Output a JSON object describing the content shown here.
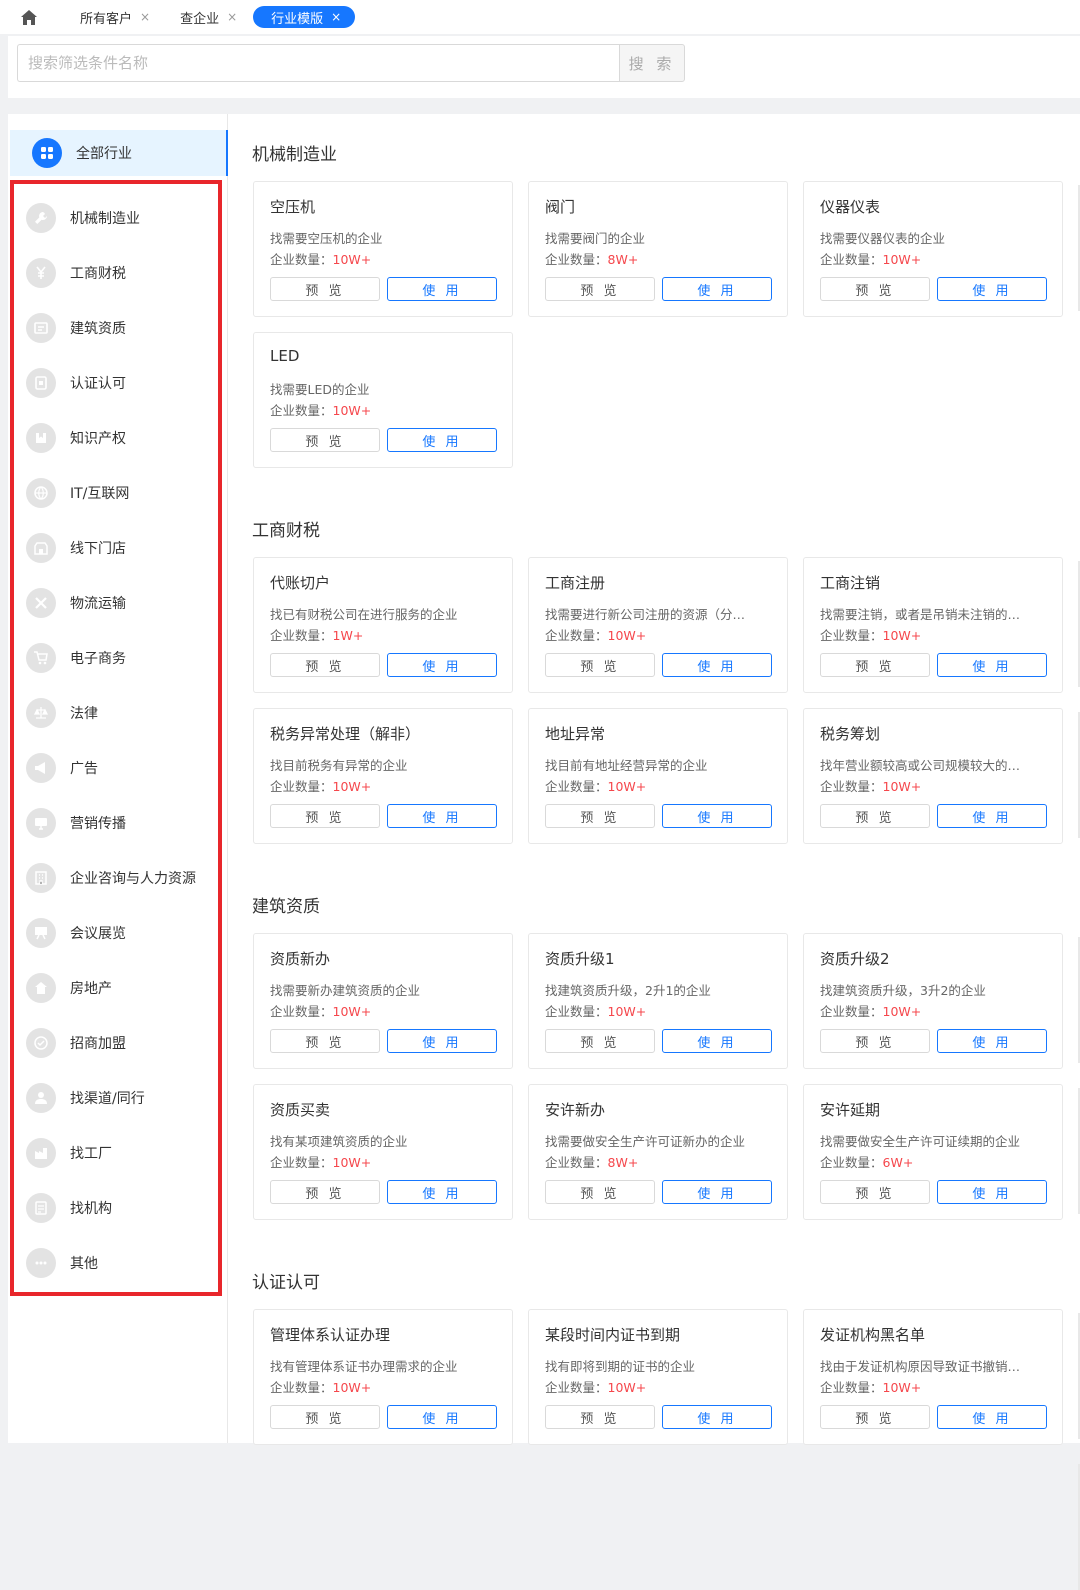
{
  "tabs": [
    {
      "label": "所有客户",
      "close": "×",
      "active": false
    },
    {
      "label": "查企业",
      "close": "×",
      "active": false
    },
    {
      "label": "行业模版",
      "close": "×",
      "active": true
    }
  ],
  "search": {
    "placeholder": "搜索筛选条件名称",
    "button_label": "搜 索"
  },
  "sidebar": {
    "all": {
      "label": "全部行业",
      "icon": "grid-icon"
    },
    "items": [
      {
        "label": "机械制造业",
        "icon": "wrench-icon"
      },
      {
        "label": "工商财税",
        "icon": "yen-icon"
      },
      {
        "label": "建筑资质",
        "icon": "certificate-icon"
      },
      {
        "label": "认证认可",
        "icon": "badge-icon"
      },
      {
        "label": "知识产权",
        "icon": "bookmark-icon"
      },
      {
        "label": "IT/互联网",
        "icon": "globe-icon"
      },
      {
        "label": "线下门店",
        "icon": "store-icon"
      },
      {
        "label": "物流运输",
        "icon": "cross-icon"
      },
      {
        "label": "电子商务",
        "icon": "cart-icon"
      },
      {
        "label": "法律",
        "icon": "scale-icon"
      },
      {
        "label": "广告",
        "icon": "megaphone-icon"
      },
      {
        "label": "营销传播",
        "icon": "monitor-icon"
      },
      {
        "label": "企业咨询与人力资源",
        "icon": "building-icon"
      },
      {
        "label": "会议展览",
        "icon": "display-icon"
      },
      {
        "label": "房地产",
        "icon": "house-icon"
      },
      {
        "label": "招商加盟",
        "icon": "handshake-icon"
      },
      {
        "label": "找渠道/同行",
        "icon": "user-icon"
      },
      {
        "label": "找工厂",
        "icon": "factory-icon"
      },
      {
        "label": "找机构",
        "icon": "institution-icon"
      },
      {
        "label": "其他",
        "icon": "more-icon"
      }
    ]
  },
  "card_labels": {
    "count_prefix": "企业数量：",
    "preview": "预 览",
    "use": "使 用"
  },
  "sections": [
    {
      "title": "机械制造业",
      "cards": [
        {
          "title": "空压机",
          "desc": "找需要空压机的企业",
          "count": "10W+"
        },
        {
          "title": "阀门",
          "desc": "找需要阀门的企业",
          "count": "8W+"
        },
        {
          "title": "仪器仪表",
          "desc": "找需要仪器仪表的企业",
          "count": "10W+"
        },
        {
          "title": "LED",
          "desc": "找需要LED的企业",
          "count": "10W+"
        }
      ]
    },
    {
      "title": "工商财税",
      "cards": [
        {
          "title": "代账切户",
          "desc": "找已有财税公司在进行服务的企业",
          "count": "1W+"
        },
        {
          "title": "工商注册",
          "desc": "找需要进行新公司注册的资源（分…",
          "count": "10W+"
        },
        {
          "title": "工商注销",
          "desc": "找需要注销，或者是吊销未注销的…",
          "count": "10W+"
        },
        {
          "title": "税务异常处理（解非）",
          "desc": "找目前税务有异常的企业",
          "count": "10W+"
        },
        {
          "title": "地址异常",
          "desc": "找目前有地址经营异常的企业",
          "count": "10W+"
        },
        {
          "title": "税务筹划",
          "desc": "找年营业额较高或公司规模较大的…",
          "count": "10W+"
        }
      ]
    },
    {
      "title": "建筑资质",
      "cards": [
        {
          "title": "资质新办",
          "desc": "找需要新办建筑资质的企业",
          "count": "10W+"
        },
        {
          "title": "资质升级1",
          "desc": "找建筑资质升级，2升1的企业",
          "count": "10W+"
        },
        {
          "title": "资质升级2",
          "desc": "找建筑资质升级，3升2的企业",
          "count": "10W+"
        },
        {
          "title": "资质买卖",
          "desc": "找有某项建筑资质的企业",
          "count": "10W+"
        },
        {
          "title": "安许新办",
          "desc": "找需要做安全生产许可证新办的企业",
          "count": "8W+"
        },
        {
          "title": "安许延期",
          "desc": "找需要做安全生产许可证续期的企业",
          "count": "6W+"
        }
      ]
    },
    {
      "title": "认证认可",
      "cards": [
        {
          "title": "管理体系认证办理",
          "desc": "找有管理体系证书办理需求的企业",
          "count": "10W+"
        },
        {
          "title": "某段时间内证书到期",
          "desc": "找有即将到期的证书的企业",
          "count": "10W+"
        },
        {
          "title": "发证机构黑名单",
          "desc": "找由于发证机构原因导致证书撤销…",
          "count": "10W+"
        }
      ]
    }
  ],
  "colors": {
    "accent": "#1677ff",
    "count": "#f5474c",
    "highlight_border": "#e8262b"
  }
}
